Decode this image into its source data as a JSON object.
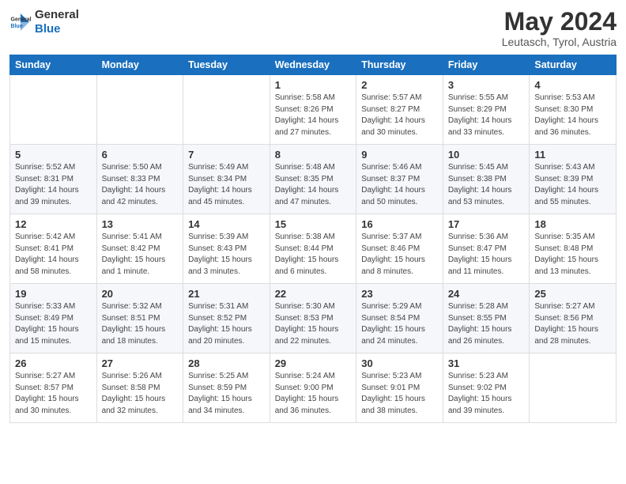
{
  "header": {
    "logo_line1": "General",
    "logo_line2": "Blue",
    "month_title": "May 2024",
    "subtitle": "Leutasch, Tyrol, Austria"
  },
  "weekdays": [
    "Sunday",
    "Monday",
    "Tuesday",
    "Wednesday",
    "Thursday",
    "Friday",
    "Saturday"
  ],
  "weeks": [
    [
      {
        "day": "",
        "info": ""
      },
      {
        "day": "",
        "info": ""
      },
      {
        "day": "",
        "info": ""
      },
      {
        "day": "1",
        "info": "Sunrise: 5:58 AM\nSunset: 8:26 PM\nDaylight: 14 hours\nand 27 minutes."
      },
      {
        "day": "2",
        "info": "Sunrise: 5:57 AM\nSunset: 8:27 PM\nDaylight: 14 hours\nand 30 minutes."
      },
      {
        "day": "3",
        "info": "Sunrise: 5:55 AM\nSunset: 8:29 PM\nDaylight: 14 hours\nand 33 minutes."
      },
      {
        "day": "4",
        "info": "Sunrise: 5:53 AM\nSunset: 8:30 PM\nDaylight: 14 hours\nand 36 minutes."
      }
    ],
    [
      {
        "day": "5",
        "info": "Sunrise: 5:52 AM\nSunset: 8:31 PM\nDaylight: 14 hours\nand 39 minutes."
      },
      {
        "day": "6",
        "info": "Sunrise: 5:50 AM\nSunset: 8:33 PM\nDaylight: 14 hours\nand 42 minutes."
      },
      {
        "day": "7",
        "info": "Sunrise: 5:49 AM\nSunset: 8:34 PM\nDaylight: 14 hours\nand 45 minutes."
      },
      {
        "day": "8",
        "info": "Sunrise: 5:48 AM\nSunset: 8:35 PM\nDaylight: 14 hours\nand 47 minutes."
      },
      {
        "day": "9",
        "info": "Sunrise: 5:46 AM\nSunset: 8:37 PM\nDaylight: 14 hours\nand 50 minutes."
      },
      {
        "day": "10",
        "info": "Sunrise: 5:45 AM\nSunset: 8:38 PM\nDaylight: 14 hours\nand 53 minutes."
      },
      {
        "day": "11",
        "info": "Sunrise: 5:43 AM\nSunset: 8:39 PM\nDaylight: 14 hours\nand 55 minutes."
      }
    ],
    [
      {
        "day": "12",
        "info": "Sunrise: 5:42 AM\nSunset: 8:41 PM\nDaylight: 14 hours\nand 58 minutes."
      },
      {
        "day": "13",
        "info": "Sunrise: 5:41 AM\nSunset: 8:42 PM\nDaylight: 15 hours\nand 1 minute."
      },
      {
        "day": "14",
        "info": "Sunrise: 5:39 AM\nSunset: 8:43 PM\nDaylight: 15 hours\nand 3 minutes."
      },
      {
        "day": "15",
        "info": "Sunrise: 5:38 AM\nSunset: 8:44 PM\nDaylight: 15 hours\nand 6 minutes."
      },
      {
        "day": "16",
        "info": "Sunrise: 5:37 AM\nSunset: 8:46 PM\nDaylight: 15 hours\nand 8 minutes."
      },
      {
        "day": "17",
        "info": "Sunrise: 5:36 AM\nSunset: 8:47 PM\nDaylight: 15 hours\nand 11 minutes."
      },
      {
        "day": "18",
        "info": "Sunrise: 5:35 AM\nSunset: 8:48 PM\nDaylight: 15 hours\nand 13 minutes."
      }
    ],
    [
      {
        "day": "19",
        "info": "Sunrise: 5:33 AM\nSunset: 8:49 PM\nDaylight: 15 hours\nand 15 minutes."
      },
      {
        "day": "20",
        "info": "Sunrise: 5:32 AM\nSunset: 8:51 PM\nDaylight: 15 hours\nand 18 minutes."
      },
      {
        "day": "21",
        "info": "Sunrise: 5:31 AM\nSunset: 8:52 PM\nDaylight: 15 hours\nand 20 minutes."
      },
      {
        "day": "22",
        "info": "Sunrise: 5:30 AM\nSunset: 8:53 PM\nDaylight: 15 hours\nand 22 minutes."
      },
      {
        "day": "23",
        "info": "Sunrise: 5:29 AM\nSunset: 8:54 PM\nDaylight: 15 hours\nand 24 minutes."
      },
      {
        "day": "24",
        "info": "Sunrise: 5:28 AM\nSunset: 8:55 PM\nDaylight: 15 hours\nand 26 minutes."
      },
      {
        "day": "25",
        "info": "Sunrise: 5:27 AM\nSunset: 8:56 PM\nDaylight: 15 hours\nand 28 minutes."
      }
    ],
    [
      {
        "day": "26",
        "info": "Sunrise: 5:27 AM\nSunset: 8:57 PM\nDaylight: 15 hours\nand 30 minutes."
      },
      {
        "day": "27",
        "info": "Sunrise: 5:26 AM\nSunset: 8:58 PM\nDaylight: 15 hours\nand 32 minutes."
      },
      {
        "day": "28",
        "info": "Sunrise: 5:25 AM\nSunset: 8:59 PM\nDaylight: 15 hours\nand 34 minutes."
      },
      {
        "day": "29",
        "info": "Sunrise: 5:24 AM\nSunset: 9:00 PM\nDaylight: 15 hours\nand 36 minutes."
      },
      {
        "day": "30",
        "info": "Sunrise: 5:23 AM\nSunset: 9:01 PM\nDaylight: 15 hours\nand 38 minutes."
      },
      {
        "day": "31",
        "info": "Sunrise: 5:23 AM\nSunset: 9:02 PM\nDaylight: 15 hours\nand 39 minutes."
      },
      {
        "day": "",
        "info": ""
      }
    ]
  ]
}
